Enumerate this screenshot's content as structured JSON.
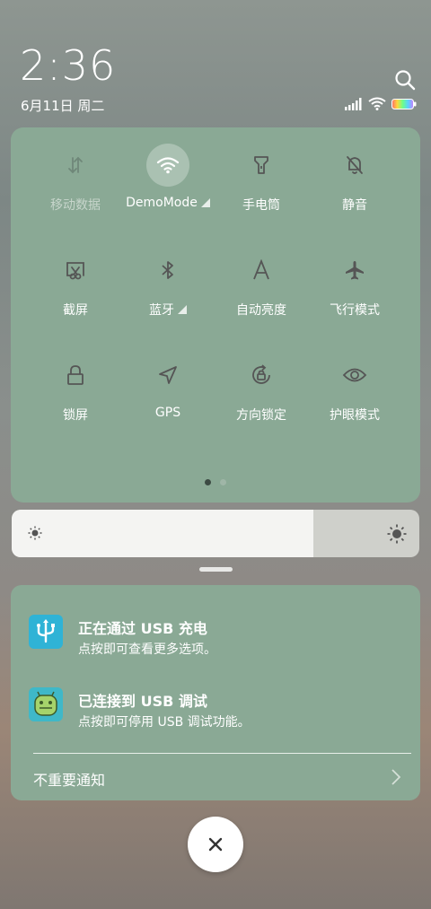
{
  "status": {
    "time": "2:36",
    "date": "6月11日 周二"
  },
  "quick_settings": {
    "tiles": [
      {
        "label": "移动数据",
        "icon": "mobile-data-icon",
        "active": false,
        "dim": true
      },
      {
        "label": "DemoMode",
        "icon": "wifi-icon",
        "active": true,
        "expandable": true
      },
      {
        "label": "手电筒",
        "icon": "flashlight-icon",
        "active": false
      },
      {
        "label": "静音",
        "icon": "mute-bell-icon",
        "active": false
      },
      {
        "label": "截屏",
        "icon": "screenshot-icon",
        "active": false
      },
      {
        "label": "蓝牙",
        "icon": "bluetooth-icon",
        "active": false,
        "expandable": true
      },
      {
        "label": "自动亮度",
        "icon": "auto-brightness-icon",
        "active": false
      },
      {
        "label": "飞行模式",
        "icon": "airplane-icon",
        "active": false
      },
      {
        "label": "锁屏",
        "icon": "lock-icon",
        "active": false
      },
      {
        "label": "GPS",
        "icon": "gps-icon",
        "active": false
      },
      {
        "label": "方向锁定",
        "icon": "rotation-lock-icon",
        "active": false
      },
      {
        "label": "护眼模式",
        "icon": "eye-icon",
        "active": false
      }
    ],
    "page_indicator": {
      "current": 1,
      "total": 2
    }
  },
  "brightness": {
    "level": 0.74
  },
  "notifications": {
    "items": [
      {
        "title": "正在通过 USB 充电",
        "subtitle": "点按即可查看更多选项。",
        "icon": "usb-icon",
        "icon_color": "#2fb3d6"
      },
      {
        "title": "已连接到 USB 调试",
        "subtitle": "点按即可停用 USB 调试功能。",
        "icon": "android-debug-icon",
        "icon_color": "#3fb8c8"
      }
    ],
    "minor_label": "不重要通知"
  }
}
